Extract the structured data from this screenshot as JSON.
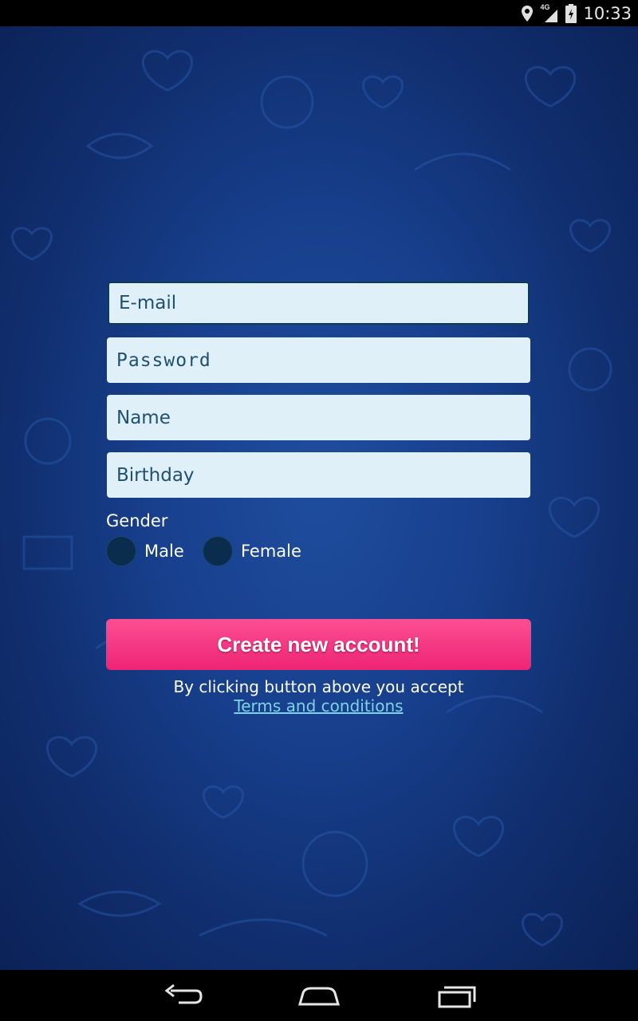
{
  "status_bar": {
    "time": "10:33",
    "network": "4G"
  },
  "form": {
    "email": {
      "placeholder": "E-mail",
      "value": ""
    },
    "password": {
      "placeholder": "Password",
      "value": ""
    },
    "name": {
      "placeholder": "Name",
      "value": ""
    },
    "birthday": {
      "placeholder": "Birthday",
      "value": ""
    },
    "gender": {
      "label": "Gender",
      "options": [
        {
          "label": "Male",
          "selected": false
        },
        {
          "label": "Female",
          "selected": false
        }
      ]
    },
    "submit_label": "Create new account!",
    "terms_prefix": "By clicking button above you accept",
    "terms_link": "Terms and conditions"
  },
  "nav_bar": {
    "back_icon": "back-icon",
    "home_icon": "home-icon",
    "recents_icon": "recents-icon"
  },
  "colors": {
    "background": "#173f8c",
    "field_bg": "#dff0f8",
    "button": "#f63b85",
    "link": "#7dd3e8"
  }
}
